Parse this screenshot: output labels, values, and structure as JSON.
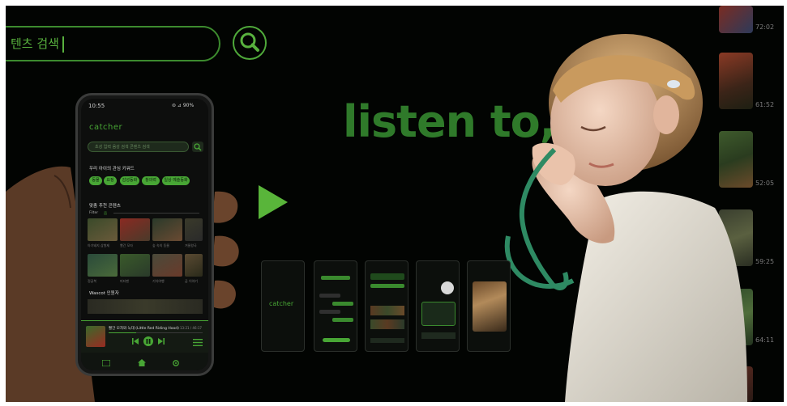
{
  "search": {
    "placeholder": "텐츠 검색"
  },
  "headline": "listen to,",
  "timestamps": [
    "72:02",
    "61:52",
    "52:05",
    "59:25",
    "64:11"
  ],
  "phone": {
    "status_time": "10:55",
    "status_icons": "⊜ ⊿ 90%",
    "app_name": "catcher",
    "search_placeholder": "초성 입력 음성 검색 콘텐츠 검색",
    "keywords_title": "우리 아이의 관심 키워드",
    "keywords": [
      "동물",
      "요정",
      "감성동화",
      "창의력",
      "일상 예술동화"
    ],
    "recommend_title": "맞춤 추천 콘텐츠",
    "filter_label": "Filter",
    "filter_value": "음",
    "row1_captions": [
      "아기돼지 삼형제",
      "빨간 모자",
      "숲 속의 동물",
      "겨울왕국"
    ],
    "row2_captions": [
      "정글북",
      "피터팬",
      "기차여행",
      "곰 이야기"
    ],
    "section2_title": "Wascot 인원자",
    "now_playing_title": "빨간 모자와 늑대 (Little Red Riding Hood)",
    "now_playing_time": "13:21 / 46:17"
  },
  "mini_screens": {
    "splash_label": "catcher"
  },
  "colors": {
    "accent": "#48a635",
    "headline": "#2f7a2a",
    "background": "#020402"
  }
}
